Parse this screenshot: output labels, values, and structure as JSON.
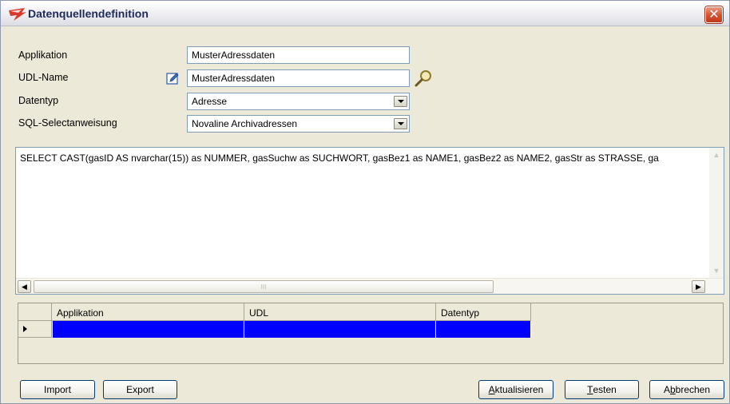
{
  "window": {
    "title": "Datenquellendefinition",
    "close_glyph": "✕",
    "icon": "app-logo-icon"
  },
  "form": {
    "applikation": {
      "label": "Applikation",
      "value": "MusterAdressdaten"
    },
    "udl_name": {
      "label": "UDL-Name",
      "value": "MusterAdressdaten",
      "edit_icon": "edit-icon",
      "search_icon": "search-icon"
    },
    "datentyp": {
      "label": "Datentyp",
      "selected": "Adresse"
    },
    "sql_select": {
      "label": "SQL-Selectanweisung",
      "selected": "Novaline Archivadressen"
    }
  },
  "sql": {
    "text": "SELECT CAST(gasID AS nvarchar(15)) as NUMMER, gasSuchw as SUCHWORT, gasBez1 as NAME1, gasBez2 as NAME2, gasStr as STRASSE, ga",
    "hscroll_grip": "III",
    "left_arrow": "<",
    "right_arrow": ">",
    "up_arrow": "^",
    "down_arrow": "v"
  },
  "grid": {
    "columns": [
      "Applikation",
      "UDL",
      "Datentyp"
    ],
    "rows": [
      [
        "",
        "",
        ""
      ]
    ],
    "selection_color": "#0000FF"
  },
  "buttons": {
    "import": "Import",
    "export": "Export",
    "aktualisieren_pre": "",
    "aktualisieren_u": "A",
    "aktualisieren_post": "ktualisieren",
    "testen_pre": "",
    "testen_u": "T",
    "testen_post": "esten",
    "abbrechen_pre": "A",
    "abbrechen_u": "b",
    "abbrechen_post": "brechen"
  }
}
